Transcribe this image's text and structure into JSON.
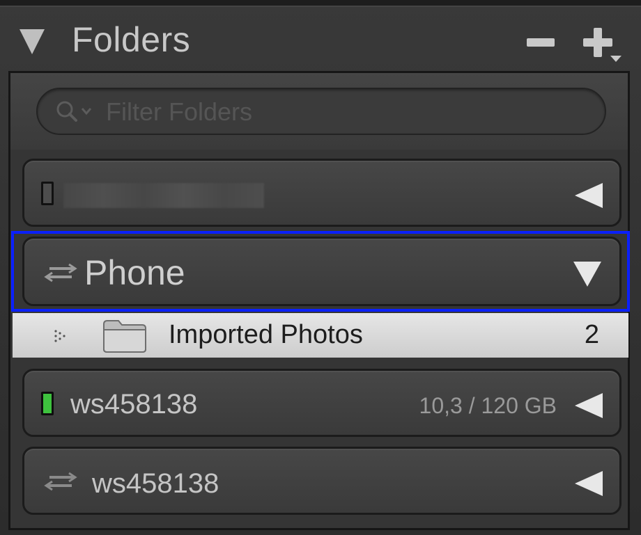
{
  "panel": {
    "title": "Folders",
    "remove_button_icon": "minus-icon",
    "add_button_icon": "plus-icon"
  },
  "filter": {
    "placeholder": "Filter Folders",
    "value": ""
  },
  "volumes": [
    {
      "name": "",
      "icon": "drive-icon",
      "indicator_color": "#4d4d4d",
      "name_hidden": true,
      "expanded": false
    },
    {
      "name": "Phone",
      "icon": "sync-icon",
      "expanded": true,
      "selected": true
    },
    {
      "name": "ws458138",
      "icon": "drive-icon",
      "indicator_color": "#3ec23e",
      "size": "10,3 / 120 GB",
      "expanded": false
    },
    {
      "name": "ws458138",
      "icon": "sync-icon",
      "expanded": false
    }
  ],
  "folders": [
    {
      "name": "Imported Photos",
      "count": "2",
      "icon": "folder-icon"
    }
  ],
  "colors": {
    "selection_outline": "#0a20ff",
    "panel_bg": "#353535",
    "folder_row_bg": "#d9d9d9"
  }
}
